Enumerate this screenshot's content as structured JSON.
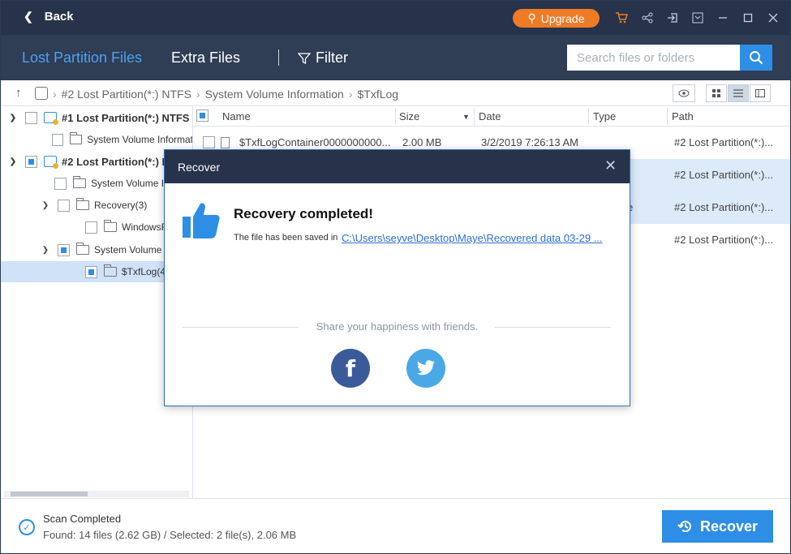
{
  "titlebar": {
    "back_label": "Back",
    "upgrade_label": "Upgrade",
    "icons": [
      "cart-icon",
      "share-icon",
      "login-icon",
      "menu-icon",
      "minimize-icon",
      "maximize-icon",
      "close-icon"
    ]
  },
  "tabs": {
    "lost_partition": "Lost Partition Files",
    "extra_files": "Extra Files",
    "filter": "Filter"
  },
  "search": {
    "placeholder": "Search files or folders"
  },
  "breadcrumb": {
    "items": [
      "#2 Lost Partition(*:) NTFS",
      "System Volume Information",
      "$TxfLog"
    ]
  },
  "tree": {
    "items": [
      {
        "label": "#1 Lost Partition(*:) NTFS"
      },
      {
        "label": "System Volume Informat"
      },
      {
        "label": "#2 Lost Partition(*:) N"
      },
      {
        "label": "System Volume In"
      },
      {
        "label": "Recovery(3)"
      },
      {
        "label": "WindowsR"
      },
      {
        "label": "System Volume In"
      },
      {
        "label": "$TxfLog(4)"
      }
    ]
  },
  "list": {
    "columns": [
      "Name",
      "Size",
      "Date",
      "Type",
      "Path"
    ],
    "rows": [
      {
        "name": "$TxfLogContainer0000000000...",
        "size": "2.00 MB",
        "date": "3/2/2019 7:26:13 AM",
        "type": "",
        "path": "#2 Lost Partition(*:)..."
      },
      {
        "name": "",
        "size": "",
        "date": "",
        "type": "",
        "path": "#2 Lost Partition(*:)..."
      },
      {
        "name": "",
        "size": "",
        "date": "",
        "type": "e",
        "path": "#2 Lost Partition(*:)..."
      },
      {
        "name": "",
        "size": "",
        "date": "",
        "type": "",
        "path": "#2 Lost Partition(*:)..."
      }
    ]
  },
  "status": {
    "title": "Scan Completed",
    "info": "Found: 14 files (2.62 GB) / Selected: 2 file(s), 2.06 MB",
    "recover_label": "Recover"
  },
  "dialog": {
    "title": "Recover",
    "heading": "Recovery completed!",
    "saved_text": "The file has been saved in",
    "path_link": "C:\\Users\\seyve\\Desktop\\Maye\\Recovered data 03-29 ...",
    "share_text": "Share your happiness with friends.",
    "facebook_glyph": "f"
  },
  "colors": {
    "titlebar": "#26334a",
    "tabbar": "#2f3d55",
    "accent": "#2e8ee6",
    "upgrade": "#f07b26",
    "facebook": "#3b5a9a",
    "twitter": "#4aa8e6"
  }
}
